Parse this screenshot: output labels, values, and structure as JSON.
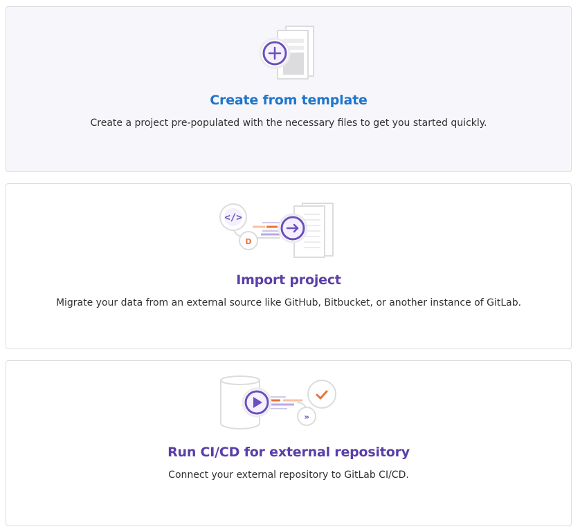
{
  "options": [
    {
      "title": "Create from template",
      "description": "Create a project pre-populated with the necessary files to get you started quickly.",
      "illustration": "template-illustration"
    },
    {
      "title": "Import project",
      "description": "Migrate your data from an external source like GitHub, Bitbucket, or another instance of GitLab.",
      "illustration": "import-illustration"
    },
    {
      "title": "Run CI/CD for external repository",
      "description": "Connect your external repository to GitLab CI/CD.",
      "illustration": "ci-cd-illustration"
    }
  ],
  "colors": {
    "template_title": "#1f75cb",
    "purple_title": "#5a3ea8",
    "accent_purple": "#6b4fbb",
    "accent_orange": "#e8733a"
  }
}
